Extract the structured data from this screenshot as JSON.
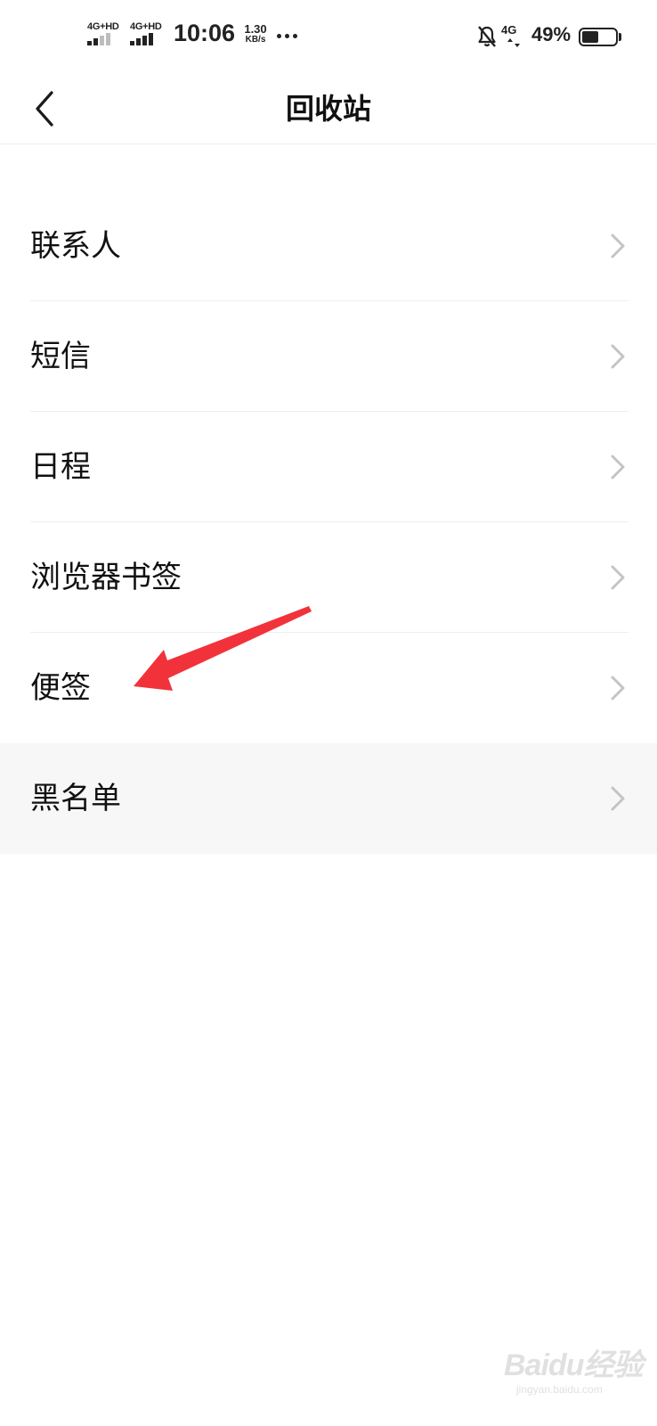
{
  "status_bar": {
    "sim1_label": "4G+HD",
    "sim2_label": "4G+HD",
    "time": "10:06",
    "speed_value": "1.30",
    "speed_unit": "KB/s",
    "data_label": "4G",
    "battery_percent": "49%",
    "battery_level": 0.49,
    "icons": [
      "signal-icon",
      "more-dots-icon",
      "bell-muted-icon",
      "network-4g-icon",
      "battery-icon"
    ]
  },
  "header": {
    "title": "回收站",
    "back_icon": "chevron-left-icon"
  },
  "list": {
    "items": [
      {
        "label": "联系人"
      },
      {
        "label": "短信"
      },
      {
        "label": "日程"
      },
      {
        "label": "浏览器书签"
      },
      {
        "label": "便签"
      },
      {
        "label": "黑名单"
      }
    ],
    "chevron_icon": "chevron-right-icon"
  },
  "annotation": {
    "arrow_color": "#f2323a",
    "points_to": "便签"
  },
  "watermark": {
    "brand": "Baidu经验",
    "url": "jingyan.baidu.com"
  },
  "colors": {
    "text": "#111111",
    "divider": "#eeeeee",
    "pressed_row": "#f7f7f7",
    "chevron": "#c4c4c4"
  }
}
